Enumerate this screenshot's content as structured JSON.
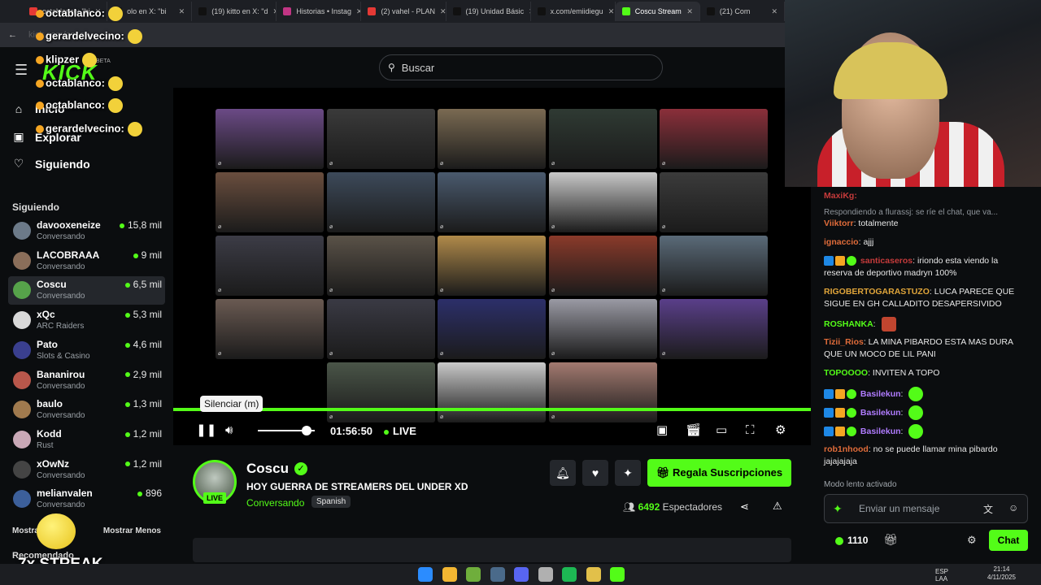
{
  "browser": {
    "tabs": [
      {
        "label": "octablanco: \"bi",
        "color": "#e53935"
      },
      {
        "label": "olo en X: \"bi",
        "color": "#111111"
      },
      {
        "label": "(19) kitto en X: \"d",
        "color": "#111111"
      },
      {
        "label": "Historias • Instag",
        "color": "#c13584"
      },
      {
        "label": "(2) vahel - PLAN",
        "color": "#e53935"
      },
      {
        "label": "(19) Unidad Básic",
        "color": "#111111"
      },
      {
        "label": "x.com/emiidiegu",
        "color": "#111111"
      },
      {
        "label": "Coscu Stream",
        "color": "#53fc18",
        "active": true
      },
      {
        "label": "(21) Com",
        "color": "#111111"
      }
    ],
    "address": "kick.com/coscu"
  },
  "overlay_chat": [
    {
      "user": "octablanco:"
    },
    {
      "user": "gerardelvecino:"
    },
    {
      "user": "klipzer"
    },
    {
      "user": "octablanco:"
    },
    {
      "user": "octablanco:"
    },
    {
      "user": "gerardelvecino:"
    }
  ],
  "streak": "7x STREAK",
  "logo": "KICK",
  "beta": "BETA",
  "nav": {
    "home": "Inicio",
    "browse": "Explorar",
    "following": "Siguiendo"
  },
  "following_section": "Siguiendo",
  "following": [
    {
      "name": "davooxeneize",
      "category": "Conversando",
      "viewers": "15,8 mil",
      "color": "#6c7a89"
    },
    {
      "name": "LACOBRAAA",
      "category": "Conversando",
      "viewers": "9 mil",
      "color": "#8a6e5a"
    },
    {
      "name": "Coscu",
      "category": "Conversando",
      "viewers": "6,5 mil",
      "color": "#56a34a",
      "active": true
    },
    {
      "name": "xQc",
      "category": "ARC Raiders",
      "viewers": "5,3 mil",
      "color": "#d9d9d9"
    },
    {
      "name": "Pato",
      "category": "Slots & Casino",
      "viewers": "4,6 mil",
      "color": "#3a3f8f"
    },
    {
      "name": "Bananirou",
      "category": "Conversando",
      "viewers": "2,9 mil",
      "color": "#b9574b"
    },
    {
      "name": "baulo",
      "category": "Conversando",
      "viewers": "1,3 mil",
      "color": "#a07a4e"
    },
    {
      "name": "Kodd",
      "category": "Rust",
      "viewers": "1,2 mil",
      "color": "#c9a8b6"
    },
    {
      "name": "xOwNz",
      "category": "Conversando",
      "viewers": "1,2 mil",
      "color": "#444444"
    },
    {
      "name": "melianvalen",
      "category": "Conversando",
      "viewers": "896",
      "color": "#3c5f9a"
    }
  ],
  "show_more": "Mostrar",
  "show_less": "Mostrar Menos",
  "recommended": "Recomendado",
  "search": {
    "placeholder": "Buscar"
  },
  "player": {
    "tooltip": "Silenciar (m)",
    "time": "01:56:50",
    "live": "LIVE",
    "volume": 0.85,
    "cams": [
      "#6b4a86",
      "#3a3a3a",
      "#7a6a52",
      "#2f3a33",
      "#8b2f3a",
      "#6a4e3e",
      "#3d4a5a",
      "#4a5a6e",
      "#c8c8c8",
      "#3b3b3b",
      "#3c3c46",
      "#5a5248",
      "#b08a4a",
      "#8a3a2a",
      "#5a6a78",
      "#6a5a52",
      "#3a3a44",
      "#2c2f6a",
      "#9a9aa4",
      "#5a3f8a",
      "#4a5548",
      "#c9c9c9",
      "#a37a70"
    ]
  },
  "channel": {
    "name": "Coscu",
    "live_badge": "LIVE",
    "title": "HOY GUERRA DE STREAMERS DEL UNDER XD",
    "category": "Conversando",
    "language": "Spanish",
    "subs_button": "Regala Suscripciones",
    "viewers": "6492",
    "viewers_label": "Espectadores"
  },
  "chat": {
    "top_user": "MaxiKg:",
    "reply": "Respondiendo a flurassj: se ríe el chat, que va...",
    "messages": [
      {
        "user": "Viiktorr",
        "text": "totalmente",
        "color": "#e06c3a"
      },
      {
        "user": "ignaccio",
        "text": "ajjj",
        "color": "#e06c3a"
      },
      {
        "user": "santicaseros",
        "text": "iriondo esta viendo la reserva de deportivo madryn 100%",
        "color": "#c63b3b"
      },
      {
        "user": "RIGOBERTOGARASTUZO",
        "text": "LUCA PARECE QUE SIGUE EN GH CALLADITO DESAPERSIVIDO",
        "color": "#e0a53a"
      },
      {
        "user": "ROSHANKA",
        "text": "",
        "color": "#53fc18"
      },
      {
        "user": "Tizii_Rios",
        "text": "LA MINA PIBARDO ESTA MAS DURA QUE UN MOCO DE LIL PANI",
        "color": "#e06c3a"
      },
      {
        "user": "TOPOOOO",
        "text": "INVITEN A TOPO",
        "color": "#53fc18"
      },
      {
        "user": "Basilekun",
        "text": "",
        "color": "#b07cff"
      },
      {
        "user": "Basilekun",
        "text": "",
        "color": "#b07cff"
      },
      {
        "user": "Basilekun",
        "text": "",
        "color": "#b07cff"
      },
      {
        "user": "rob1nhood",
        "text": "no se puede llamar mina pibardo jajajajaja",
        "color": "#e06c3a"
      }
    ],
    "slow_mode": "Modo lento activado",
    "input_placeholder": "Enviar un mensaje",
    "points": "1110",
    "send_button": "Chat"
  },
  "taskbar": {
    "lang1": "ESP",
    "lang2": "LAA",
    "time": "21:14",
    "date": "4/11/2025"
  }
}
